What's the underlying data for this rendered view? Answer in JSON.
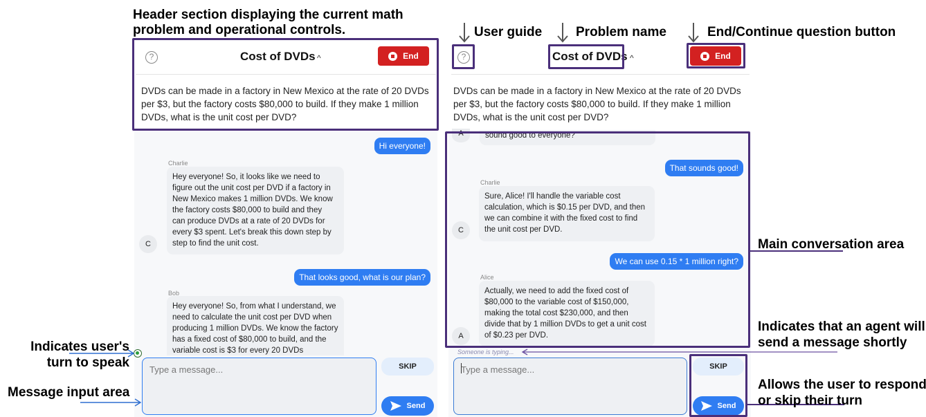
{
  "annotations": {
    "header_section_line1": "Header section displaying the current math",
    "header_section_line2": "problem and operational controls.",
    "user_guide": "User guide",
    "problem_name": "Problem name",
    "end_continue": "End/Continue question button",
    "main_conversation": "Main conversation area",
    "agent_will_send_line1": "Indicates that an agent will",
    "agent_will_send_line2": "send a message shortly",
    "users_turn_line1": "Indicates user's",
    "users_turn_line2": "turn to speak",
    "message_input": "Message input area",
    "respond_skip_line1": "Allows the user to respond",
    "respond_skip_line2": "or skip their turn"
  },
  "header": {
    "problem_title": "Cost of DVDs",
    "end_label": "End",
    "help_glyph": "?",
    "chevron": "^"
  },
  "problem": {
    "line1": "DVDs can be made in a factory in New Mexico at the rate of 20 DVDs",
    "line2": "per $3, but the factory costs $80,000 to build. If they make 1 million",
    "line3": "DVDs, what is the unit cost per DVD?"
  },
  "left_chat": {
    "user_msg1": "Hi everyone!",
    "charlie_name": "Charlie",
    "charlie_avatar": "C",
    "charlie_lines": [
      "Hey everyone! So, it looks like we need to",
      "figure out the unit cost per DVD if a factory in",
      "New Mexico makes 1 million DVDs. We know",
      "the factory costs $80,000 to build and they",
      "can produce DVDs at a rate of 20 DVDs for",
      "every $3 spent. Let's break this down step by",
      "step to find the unit cost."
    ],
    "user_msg2": "That looks good, what is our plan?",
    "bob_name": "Bob",
    "bob_lines": [
      "Hey everyone! So, from what I understand, we",
      "need to calculate the unit cost per DVD when",
      "producing 1 million DVDs. We know the factory",
      "has a fixed cost of $80,000 to build, and the",
      "variable cost is $3 for every 20 DVDs"
    ]
  },
  "right_chat": {
    "top_avatar": "A",
    "top_msg": "sound good to everyone?",
    "user_msg1": "That sounds good!",
    "charlie_name": "Charlie",
    "charlie_avatar": "C",
    "charlie_lines": [
      "Sure, Alice! I'll handle the variable cost",
      "calculation, which is $0.15 per DVD, and then",
      "we can combine it with the fixed cost to find",
      "the unit cost per DVD."
    ],
    "user_msg2": "We can use 0.15 * 1 million right?",
    "alice_name": "Alice",
    "alice_avatar": "A",
    "alice_lines": [
      "Actually, we need to add the fixed cost of",
      "$80,000 to the variable cost of $150,000,",
      "making the total cost $230,000, and then",
      "divide that by 1 million DVDs to get a unit cost",
      "of $0.23 per DVD."
    ],
    "typing": "Someone is typing..."
  },
  "input": {
    "placeholder": "Type a message...",
    "skip_label": "SKIP",
    "send_label": "Send"
  },
  "colors": {
    "accent": "#2f7df2",
    "annotation_purple": "#4a2f7a",
    "end_red": "#d32121"
  }
}
